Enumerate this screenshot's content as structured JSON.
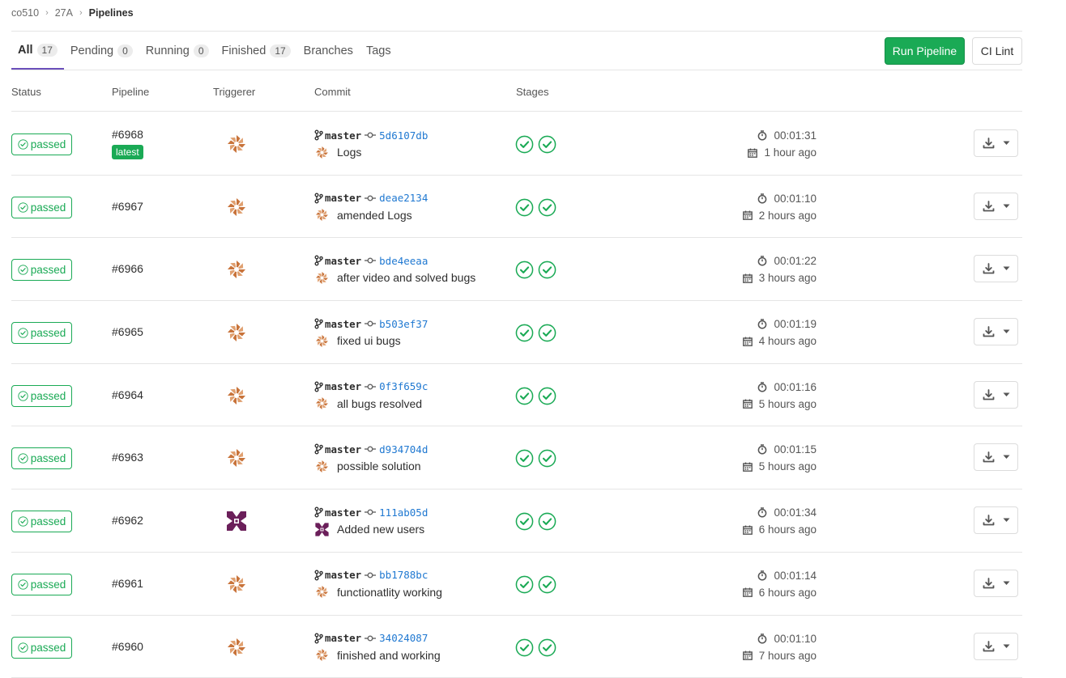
{
  "breadcrumb": [
    "co510",
    "27A",
    "Pipelines"
  ],
  "tabs": [
    {
      "label": "All",
      "count": "17"
    },
    {
      "label": "Pending",
      "count": "0"
    },
    {
      "label": "Running",
      "count": "0"
    },
    {
      "label": "Finished",
      "count": "17"
    },
    {
      "label": "Branches",
      "count": null
    },
    {
      "label": "Tags",
      "count": null
    }
  ],
  "actions": {
    "run_pipeline": "Run Pipeline",
    "ci_lint": "CI Lint"
  },
  "columns": {
    "status": "Status",
    "pipeline": "Pipeline",
    "triggerer": "Triggerer",
    "commit": "Commit",
    "stages": "Stages"
  },
  "colors": {
    "success": "#1aaa55",
    "link": "#1f78d1",
    "tab_active": "#6b4fbb",
    "avatar_orange": "#c8733a",
    "avatar_purple": "#6b1f5a"
  },
  "pipelines": [
    {
      "status": "passed",
      "id": "#6968",
      "badge": "latest",
      "avatar": "orange",
      "branch": "master",
      "sha": "5d6107db",
      "message": "Logs",
      "duration": "00:01:31",
      "ago": "1 hour ago"
    },
    {
      "status": "passed",
      "id": "#6967",
      "badge": null,
      "avatar": "orange",
      "branch": "master",
      "sha": "deae2134",
      "message": "amended Logs",
      "duration": "00:01:10",
      "ago": "2 hours ago"
    },
    {
      "status": "passed",
      "id": "#6966",
      "badge": null,
      "avatar": "orange",
      "branch": "master",
      "sha": "bde4eeaa",
      "message": "after video and solved bugs",
      "duration": "00:01:22",
      "ago": "3 hours ago"
    },
    {
      "status": "passed",
      "id": "#6965",
      "badge": null,
      "avatar": "orange",
      "branch": "master",
      "sha": "b503ef37",
      "message": "fixed ui bugs",
      "duration": "00:01:19",
      "ago": "4 hours ago"
    },
    {
      "status": "passed",
      "id": "#6964",
      "badge": null,
      "avatar": "orange",
      "branch": "master",
      "sha": "0f3f659c",
      "message": "all bugs resolved",
      "duration": "00:01:16",
      "ago": "5 hours ago"
    },
    {
      "status": "passed",
      "id": "#6963",
      "badge": null,
      "avatar": "orange",
      "branch": "master",
      "sha": "d934704d",
      "message": "possible solution",
      "duration": "00:01:15",
      "ago": "5 hours ago"
    },
    {
      "status": "passed",
      "id": "#6962",
      "badge": null,
      "avatar": "purple",
      "branch": "master",
      "sha": "111ab05d",
      "message": "Added new users",
      "duration": "00:01:34",
      "ago": "6 hours ago"
    },
    {
      "status": "passed",
      "id": "#6961",
      "badge": null,
      "avatar": "orange",
      "branch": "master",
      "sha": "bb1788bc",
      "message": "functionatlity working",
      "duration": "00:01:14",
      "ago": "6 hours ago"
    },
    {
      "status": "passed",
      "id": "#6960",
      "badge": null,
      "avatar": "orange",
      "branch": "master",
      "sha": "34024087",
      "message": "finished and working",
      "duration": "00:01:10",
      "ago": "7 hours ago"
    }
  ]
}
